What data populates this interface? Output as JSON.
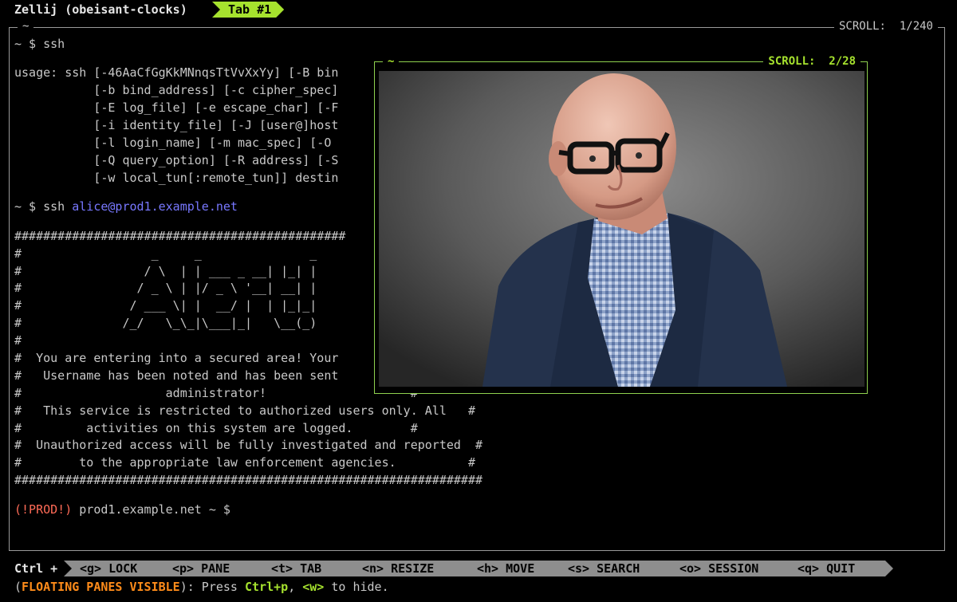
{
  "topbar": {
    "app_title": "Zellij (obeisant-clocks)",
    "active_tab": "Tab #1"
  },
  "main_pane": {
    "title": "~",
    "scroll": "SCROLL:  1/240",
    "lines": [
      "~ $ ssh",
      "",
      "usage: ssh [-46AaCfGgKkMNnqsTtVvXxYy] [-B bin",
      "           [-b bind_address] [-c cipher_spec]",
      "           [-E log_file] [-e escape_char] [-F",
      "           [-i identity_file] [-J [user@]host",
      "           [-l login_name] [-m mac_spec] [-O",
      "           [-Q query_option] [-R address] [-S",
      "           [-w local_tun[:remote_tun]] destin",
      "",
      "##############################################",
      "#                  _     _               _",
      "#                 / \\  | | ___ _ __| |_| |",
      "#                / _ \\ | |/ _ \\ '__| __| |",
      "#               / ___ \\| |  __/ |  | |_|_|",
      "#              /_/   \\_\\_|\\___|_|   \\__(_)",
      "#",
      "#  You are entering into a secured area! Your",
      "#   Username has been noted and has been sent",
      "#                    administrator!                    #",
      "#   This service is restricted to authorized users only. All   #",
      "#         activities on this system are logged.        #",
      "#  Unauthorized access will be fully investigated and reported  #",
      "#        to the appropriate law enforcement agencies.          #",
      "#################################################################",
      ""
    ],
    "ssh_prompt": "~ $ ssh ",
    "ssh_host": "alice@prod1.example.net",
    "final_prompt_tag": "(!PROD!)",
    "final_prompt_rest": " prod1.example.net ~ $"
  },
  "floating_pane": {
    "title": "~",
    "scroll": "SCROLL:  2/28"
  },
  "keybar": {
    "ctrl_label": "Ctrl +",
    "keys": [
      "<g> LOCK",
      "<p> PANE",
      "<t> TAB",
      "<n> RESIZE",
      "<h> MOVE",
      "<s> SEARCH",
      "<o> SESSION",
      "<q> QUIT"
    ]
  },
  "hint": {
    "open_paren": "(",
    "floating_label": "FLOATING PANES VISIBLE",
    "text1": "): Press ",
    "combo": "Ctrl+p",
    "text2": ", ",
    "key": "<w>",
    "text3": " to hide."
  },
  "colors": {
    "accent_green": "#a6e22e",
    "prod_red": "#ff6b57",
    "host_blue": "#7878ff",
    "hint_orange": "#ff8c1a"
  }
}
